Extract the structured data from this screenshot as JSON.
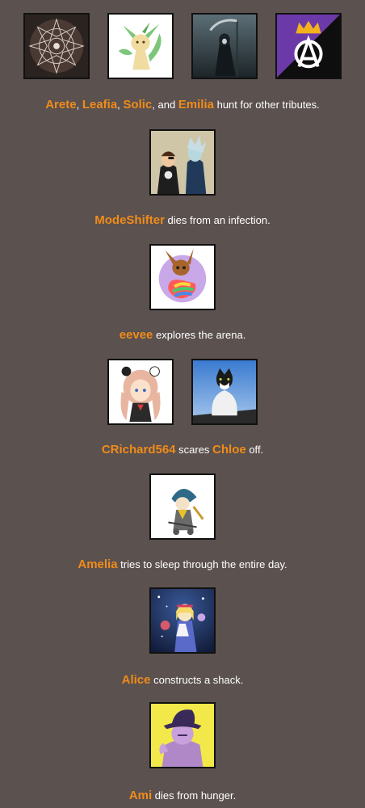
{
  "events": [
    {
      "avatars": [
        "mandala-avatar-icon",
        "leafeon-avatar-icon",
        "reaper-avatar-icon",
        "anarchy-crown-avatar-icon"
      ],
      "parts": [
        {
          "t": "Arete",
          "name": true
        },
        {
          "t": ", ",
          "name": false
        },
        {
          "t": "Leafia",
          "name": true
        },
        {
          "t": ", ",
          "name": false
        },
        {
          "t": "Solic",
          "name": true
        },
        {
          "t": ", and ",
          "name": false
        },
        {
          "t": "Emilia",
          "name": true
        },
        {
          "t": " hunt for other tributes.",
          "name": false
        }
      ]
    },
    {
      "avatars": [
        "duo-portrait-avatar-icon"
      ],
      "parts": [
        {
          "t": "ModeShifter",
          "name": true
        },
        {
          "t": " dies from an infection.",
          "name": false
        }
      ]
    },
    {
      "avatars": [
        "eevee-avatar-icon"
      ],
      "parts": [
        {
          "t": "eevee",
          "name": true
        },
        {
          "t": " explores the arena.",
          "name": false
        }
      ]
    },
    {
      "avatars": [
        "anime-girl-avatar-icon",
        "cat-avatar-icon"
      ],
      "parts": [
        {
          "t": "CRichard564",
          "name": true
        },
        {
          "t": " scares ",
          "name": false
        },
        {
          "t": "Chloe",
          "name": true
        },
        {
          "t": " off.",
          "name": false
        }
      ]
    },
    {
      "avatars": [
        "knight-sketch-avatar-icon"
      ],
      "parts": [
        {
          "t": "Amelia",
          "name": true
        },
        {
          "t": " tries to sleep through the entire day.",
          "name": false
        }
      ]
    },
    {
      "avatars": [
        "alice-avatar-icon"
      ],
      "parts": [
        {
          "t": "Alice",
          "name": true
        },
        {
          "t": " constructs a shack.",
          "name": false
        }
      ]
    },
    {
      "avatars": [
        "hat-figure-avatar-icon"
      ],
      "parts": [
        {
          "t": "Ami",
          "name": true
        },
        {
          "t": " dies from hunger.",
          "name": false
        }
      ]
    }
  ],
  "colors": {
    "background": "#5b514f",
    "name": "#f08c1a",
    "text": "#ffffff"
  }
}
